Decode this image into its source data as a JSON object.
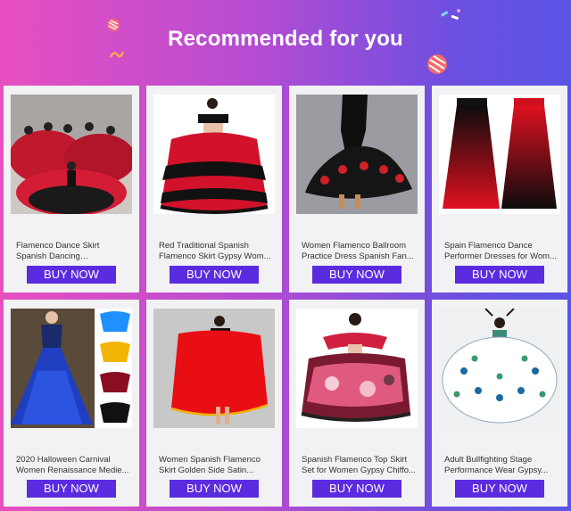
{
  "header": {
    "title": "Recommended for you"
  },
  "colors": {
    "button": "#5b2be0",
    "card_bg": "#f2f2f4",
    "banner_left": "#e84fc0",
    "banner_right": "#5a55e6"
  },
  "products": [
    {
      "title": "Flamenco Dance Skirt Spanish Dancing Performance Costu...",
      "button": "BUY NOW"
    },
    {
      "title": "Red Traditional Spanish Flamenco Skirt Gypsy Wom...",
      "button": "BUY NOW"
    },
    {
      "title": "Women Flamenco Ballroom Practice Dress Spanish Fan...",
      "button": "BUY NOW"
    },
    {
      "title": "Spain Flamenco Dance Performer Dresses for Wom...",
      "button": "BUY NOW"
    },
    {
      "title": "2020 Halloween Carnival Women Renaissance Medie...",
      "button": "BUY NOW"
    },
    {
      "title": "Women Spanish Flamenco Skirt Golden Side Satin...",
      "button": "BUY NOW"
    },
    {
      "title": "Spanish Flamenco Top Skirt Set for Women Gypsy Chiffo...",
      "button": "BUY NOW"
    },
    {
      "title": "Adult Bullfighting Stage Performance Wear Gypsy...",
      "button": "BUY NOW"
    }
  ]
}
